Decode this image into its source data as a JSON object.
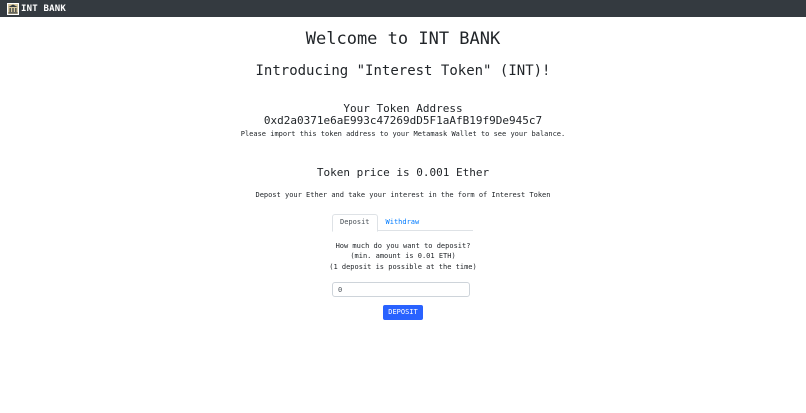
{
  "navbar": {
    "brand_icon": "bank-icon",
    "brand_text": "INT BANK"
  },
  "hero": {
    "title": "Welcome to INT BANK",
    "subtitle": "Introducing \"Interest Token\" (INT)!"
  },
  "token": {
    "heading": "Your Token Address",
    "address": "0xd2a0371e6aE993c47269dD5F1aAfB19f9De945c7",
    "note": "Please import this token address to your Metamask Wallet to see your balance."
  },
  "price": {
    "text": "Token price is 0.001 Ether",
    "description": "Depost your Ether and take your interest in the form of Interest Token"
  },
  "tabs": [
    {
      "label": "Deposit",
      "active": true
    },
    {
      "label": "Withdraw",
      "active": false
    }
  ],
  "deposit_form": {
    "question": "How much do you want to deposit?",
    "min_amount": "(min. amount is 0.01 ETH)",
    "limit_note": "(1 deposit is possible at the time)",
    "amount_value": "0",
    "button_label": "DEPOSIT"
  },
  "colors": {
    "navbar_bg": "#343a40",
    "accent": "#2962ff",
    "link": "#007bff"
  }
}
